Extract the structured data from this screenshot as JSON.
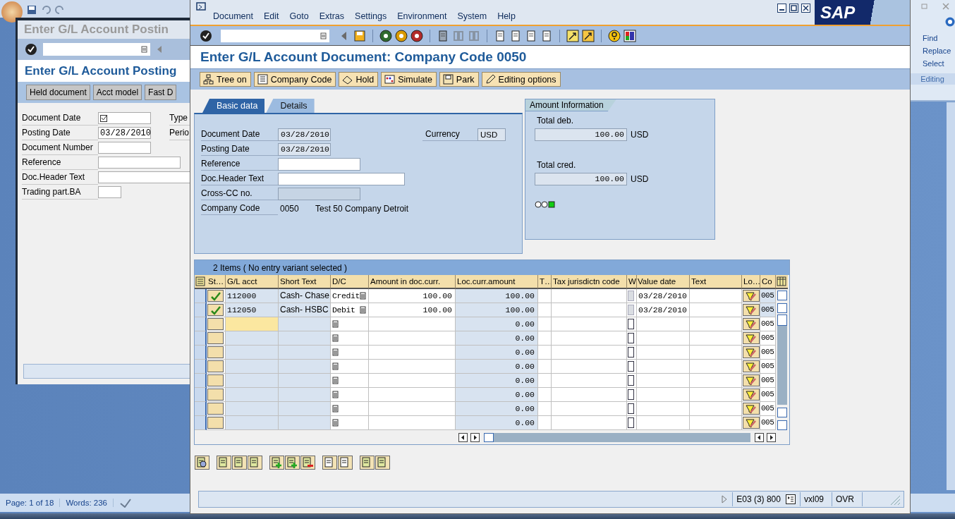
{
  "word": {
    "ribbon": [
      {
        "label": "Find"
      },
      {
        "label": "Replace"
      },
      {
        "label": "Select"
      }
    ],
    "group": "Editing",
    "status": [
      "Page: 1 of 18",
      "Words: 236"
    ]
  },
  "back_window": {
    "title": "Enter G/L Account Postin",
    "heading": "Enter G/L Account Posting",
    "buttons": [
      "Held document",
      "Acct model",
      "Fast D"
    ],
    "fields": [
      {
        "label": "Document Date",
        "kind": "check"
      },
      {
        "label": "Posting Date",
        "value": "03/28/2010",
        "kind": "input"
      },
      {
        "label": "Document Number",
        "kind": "input"
      },
      {
        "label": "Reference",
        "kind": "input"
      },
      {
        "label": "Doc.Header Text",
        "kind": "input"
      },
      {
        "label": "Trading part.BA",
        "kind": "input"
      }
    ],
    "side_labels": [
      "Type",
      "Perio"
    ]
  },
  "window": {
    "menu": [
      "Document",
      "Edit",
      "Goto",
      "Extras",
      "Settings",
      "Environment",
      "System",
      "Help"
    ],
    "logo": "SAP",
    "title": "Enter G/L Account Document: Company Code 0050",
    "buttons": [
      "Tree on",
      "Company Code",
      "Hold",
      "Simulate",
      "Park",
      "Editing options"
    ],
    "tabs": [
      {
        "label": "Basic data",
        "selected": true
      },
      {
        "label": "Details",
        "selected": false
      }
    ],
    "fields": [
      {
        "label": "Document Date",
        "value": "03/28/2010",
        "kind": "readonly"
      },
      {
        "label": "Posting Date",
        "value": "03/28/2010",
        "kind": "readonly"
      },
      {
        "label": "Reference",
        "kind": "input"
      },
      {
        "label": "Doc.Header Text",
        "kind": "input"
      },
      {
        "label": "Cross-CC no.",
        "kind": "disabled"
      },
      {
        "label": "Company Code",
        "value": "0050",
        "description": "Test 50 Company Detroit",
        "kind": "text"
      }
    ],
    "currency": {
      "label": "Currency",
      "value": "USD"
    },
    "amount_info": {
      "title": "Amount Information",
      "totals": [
        {
          "label": "Total deb.",
          "value": "100.00",
          "currency": "USD"
        },
        {
          "label": "Total cred.",
          "value": "100.00",
          "currency": "USD"
        }
      ],
      "balanced": true
    },
    "table": {
      "title": "2 Items ( No entry variant selected )",
      "columns": [
        "St…",
        "G/L acct",
        "Short Text",
        "D/C",
        "Amount in doc.curr.",
        "Loc.curr.amount",
        "T…",
        "Tax jurisdictn code",
        "W",
        "Value date",
        "Text",
        "Lo…",
        "Co"
      ],
      "rows": [
        {
          "ok": true,
          "gl_acct": "112000",
          "short_text": "Cash- Chase",
          "dc": "Credit",
          "amount": "100.00",
          "loc_amount": "100.00",
          "w_checked": false,
          "w_disabled": true,
          "value_date": "03/28/2010",
          "co": "005",
          "focused": false
        },
        {
          "ok": true,
          "gl_acct": "112050",
          "short_text": "Cash- HSBC",
          "dc": "Debit",
          "amount": "100.00",
          "loc_amount": "100.00",
          "w_checked": false,
          "w_disabled": true,
          "value_date": "03/28/2010",
          "co": "005",
          "focused": false
        },
        {
          "ok": false,
          "loc_amount": "0.00",
          "w_checked": false,
          "w_disabled": false,
          "co": "005",
          "focused": true
        },
        {
          "ok": false,
          "loc_amount": "0.00",
          "w_checked": false,
          "w_disabled": false,
          "co": "005",
          "focused": false
        },
        {
          "ok": false,
          "loc_amount": "0.00",
          "w_checked": false,
          "w_disabled": false,
          "co": "005",
          "focused": false
        },
        {
          "ok": false,
          "loc_amount": "0.00",
          "w_checked": false,
          "w_disabled": false,
          "co": "005",
          "focused": false
        },
        {
          "ok": false,
          "loc_amount": "0.00",
          "w_checked": false,
          "w_disabled": false,
          "co": "005",
          "focused": false
        },
        {
          "ok": false,
          "loc_amount": "0.00",
          "w_checked": false,
          "w_disabled": false,
          "co": "005",
          "focused": false
        },
        {
          "ok": false,
          "loc_amount": "0.00",
          "w_checked": false,
          "w_disabled": false,
          "co": "005",
          "focused": false
        },
        {
          "ok": false,
          "loc_amount": "0.00",
          "w_checked": false,
          "w_disabled": false,
          "co": "005",
          "focused": false
        }
      ]
    },
    "status_bar": [
      "E03 (3) 800",
      "vxl09",
      "OVR"
    ]
  }
}
